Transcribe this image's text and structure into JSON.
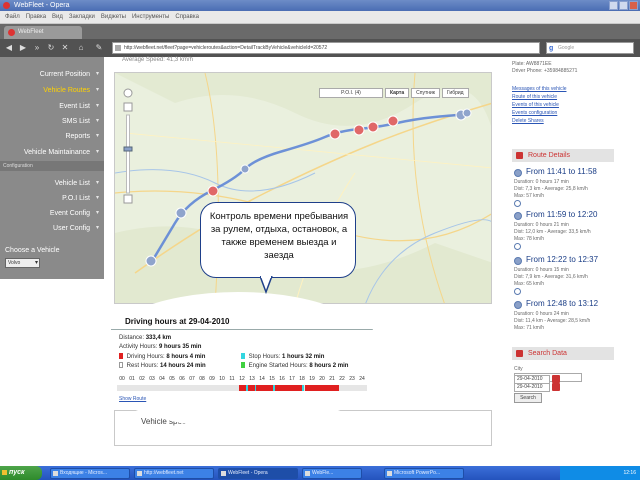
{
  "window": {
    "title": "WebFleet - Opera",
    "tab_label": "WebFleet",
    "menu": [
      "Файл",
      "Правка",
      "Вид",
      "Закладки",
      "Виджеты",
      "Инструменты",
      "Справка"
    ]
  },
  "navbar": {
    "url": "http://webfleet.net/fleet?page=vehicleroutes&action=DetailTrackByVehicle&vehicleId=20572",
    "search_placeholder": "Google"
  },
  "sidebar": {
    "items": [
      {
        "label": "Current Position",
        "active": false
      },
      {
        "label": "Vehicle Routes",
        "active": true
      },
      {
        "label": "Event List",
        "active": false
      },
      {
        "label": "SMS List",
        "active": false
      },
      {
        "label": "Reports",
        "active": false
      },
      {
        "label": "Vehicle Maintainance",
        "active": false
      }
    ],
    "config_items": [
      {
        "label": "Vehicle List"
      },
      {
        "label": "P.O.I List"
      },
      {
        "label": "Event Config"
      },
      {
        "label": "User Config"
      }
    ],
    "section_label": "Configuration",
    "choose_label": "Choose a Vehicle",
    "vehicle_value": "Volvo"
  },
  "main": {
    "avg_speed": "Average Speed: 41,3 km/h",
    "map_buttons": {
      "poi": "P.O.I. (4)",
      "map": "Карта",
      "satellite": "Спутник",
      "hybrid": "Гибрид"
    },
    "speed_title": "Vehicle speed"
  },
  "right_panel": {
    "plate": "Plate: AW8871EE",
    "driver_phone": "Driver Phone: +35984885271",
    "links": [
      "Messages of this vehicle",
      "Route of this vehicle",
      "Events of this vehicle",
      "Events configuration",
      "Delete Shares"
    ],
    "route_details_title": "Route Details",
    "routes": [
      {
        "title": "From 11:41 to 11:58",
        "detail1": "Duration: 0 hours 17 min",
        "detail2": "Dist: 7,3 km - Average: 25,8 km/h",
        "detail3": "Max: 57 km/h"
      },
      {
        "title": "From 11:59 to 12:20",
        "detail1": "Duration: 0 hours 21 min",
        "detail2": "Dist: 12,0 km - Average: 33,5 km/h",
        "detail3": "Max: 78 km/h"
      },
      {
        "title": "From 12:22 to 12:37",
        "detail1": "Duration: 0 hours 15 min",
        "detail2": "Dist: 7,9 km - Average: 31,6 km/h",
        "detail3": "Max: 65 km/h"
      },
      {
        "title": "From 12:48 to 13:12",
        "detail1": "Duration: 0 hours 24 min",
        "detail2": "Dist: 11,4 km - Average: 28,5 km/h",
        "detail3": "Max: 71 km/h"
      }
    ],
    "search_title": "Search Data",
    "search_city_label": "City",
    "date_from": "29-04-2010",
    "date_to": "29-04-2010",
    "search_button": "Search"
  },
  "bubble": {
    "text": "Контроль времени пребывания за рулем, отдыха, остановок, а также временем выезда и заезда"
  },
  "driving_hours": {
    "title": "Driving hours at 29-04-2010",
    "distance_label": "Distance:",
    "distance_value": "333,4 km",
    "activity_label": "Activity Hours:",
    "activity_value": "9 hours 35 min",
    "driving_label": "Driving Hours:",
    "driving_value": "8 hours 4 min",
    "stop_label": "Stop Hours:",
    "stop_value": "1 hours 32 min",
    "rest_label": "Rest Hours:",
    "rest_value": "14 hours 24 min",
    "engine_label": "Engine Started Hours:",
    "engine_value": "8 hours 2 min",
    "hour_ticks": [
      "00",
      "01",
      "02",
      "03",
      "04",
      "05",
      "06",
      "07",
      "08",
      "09",
      "10",
      "11",
      "12",
      "13",
      "14",
      "15",
      "16",
      "17",
      "18",
      "19",
      "20",
      "21",
      "22",
      "23",
      "24"
    ],
    "show_route": "Show Route",
    "colors": {
      "driving": "#e02020",
      "stop": "#33d6e0",
      "rest": "#ffffff",
      "engine": "#40d040"
    },
    "segments": [
      {
        "type": "rest",
        "start": 0,
        "end": 11.7
      },
      {
        "type": "driving",
        "start": 11.7,
        "end": 12.4
      },
      {
        "type": "stop",
        "start": 12.4,
        "end": 12.6
      },
      {
        "type": "driving",
        "start": 12.6,
        "end": 13.2
      },
      {
        "type": "stop",
        "start": 13.2,
        "end": 13.35
      },
      {
        "type": "driving",
        "start": 13.35,
        "end": 15.0
      },
      {
        "type": "stop",
        "start": 15.0,
        "end": 15.15
      },
      {
        "type": "driving",
        "start": 15.15,
        "end": 17.8
      },
      {
        "type": "stop",
        "start": 17.8,
        "end": 18.0
      },
      {
        "type": "driving",
        "start": 18.0,
        "end": 21.3
      },
      {
        "type": "rest",
        "start": 21.3,
        "end": 24
      }
    ]
  },
  "taskbar": {
    "start_label": "пуск",
    "tasks": [
      "Входящие - Micros...",
      "http://webfleet.net",
      "WebFleet - Opera",
      "WebFle...",
      "Microsoft PowerPo..."
    ],
    "clock": "12:16"
  }
}
